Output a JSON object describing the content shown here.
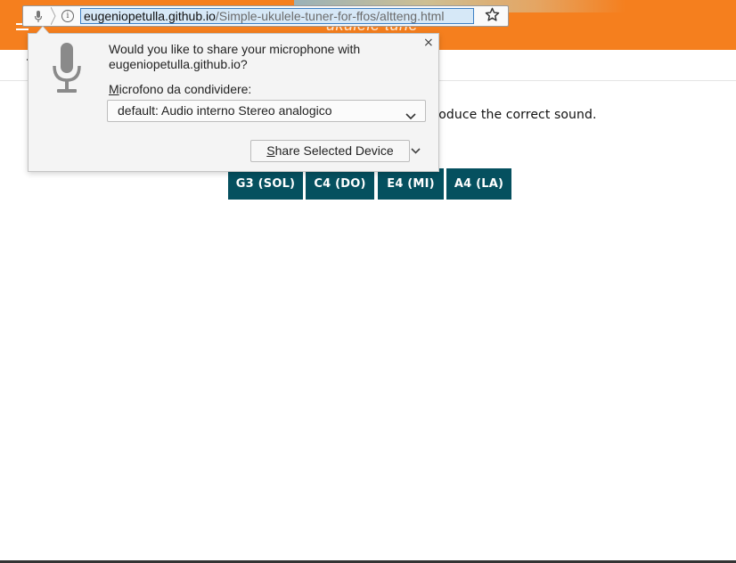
{
  "browser": {
    "url_host": "eugeniopetulla.github.io",
    "url_path": "/Simple-ukulele-tuner-for-ffos/altteng.html",
    "info_icon_glyph": "i"
  },
  "page": {
    "header_title": "ukulele tune",
    "instruction_text": "e button to reproduce the correct sound.",
    "header_color": "#f57f1e",
    "button_color": "#05505f",
    "tone_buttons": [
      "G3 (SOL)",
      "C4 (DO)",
      "E4 (MI)",
      "A4 (LA)"
    ]
  },
  "permission_popup": {
    "question": "Would you like to share your microphone with eugeniopetulla.github.io?",
    "device_label_accesskey": "M",
    "device_label_rest": "icrofono da condividere:",
    "selected_device": "default: Audio interno Stereo analogico",
    "share_accesskey": "S",
    "share_rest": "hare Selected Device",
    "close_glyph": "×"
  },
  "icons": {
    "url_mic": "microphone-icon",
    "info": "info-icon",
    "star": "star-icon",
    "popup_mic": "microphone-icon",
    "select_chevron": "chevron-down-icon",
    "menu": "hamburger-menu-icon"
  }
}
